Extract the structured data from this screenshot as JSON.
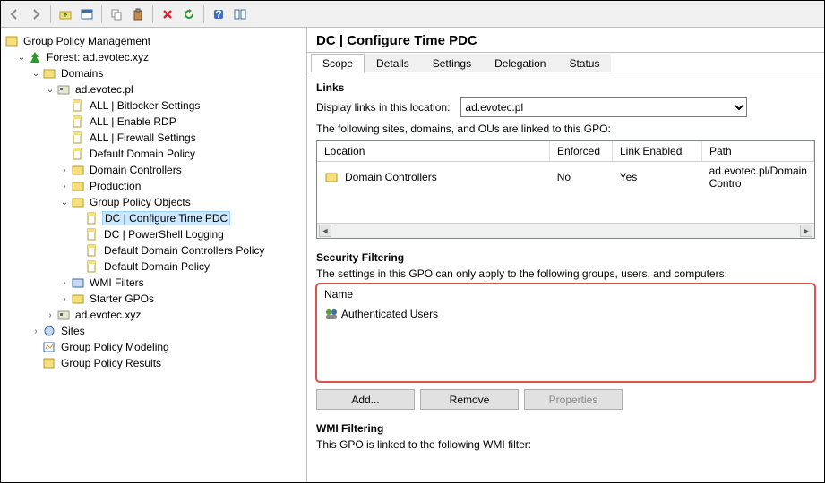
{
  "toolbar_icons": [
    "arrow-left-icon",
    "arrow-right-icon",
    "folder-up-icon",
    "window-icon",
    "copy-icon",
    "paste-icon",
    "delete-icon",
    "refresh-icon",
    "help-icon",
    "tile-icon"
  ],
  "tree": {
    "root": "Group Policy Management",
    "forest": "Forest: ad.evotec.xyz",
    "domains": "Domains",
    "domain": "ad.evotec.pl",
    "items": [
      "ALL | Bitlocker Settings",
      "ALL | Enable RDP",
      "ALL | Firewall Settings",
      "Default Domain Policy",
      "Domain Controllers",
      "Production",
      "Group Policy Objects"
    ],
    "gpo_children": [
      "DC | Configure Time PDC",
      "DC | PowerShell Logging",
      "Default Domain Controllers Policy",
      "Default Domain Policy"
    ],
    "after": [
      "WMI Filters",
      "Starter GPOs"
    ],
    "domain2": "ad.evotec.xyz",
    "sites": "Sites",
    "modeling": "Group Policy Modeling",
    "results": "Group Policy Results"
  },
  "header": "DC | Configure Time PDC",
  "tabs": [
    "Scope",
    "Details",
    "Settings",
    "Delegation",
    "Status"
  ],
  "links": {
    "title": "Links",
    "display": "Display links in this location:",
    "combo": "ad.evotec.pl",
    "caption": "The following sites, domains, and OUs are linked to this GPO:",
    "cols": [
      "Location",
      "Enforced",
      "Link Enabled",
      "Path"
    ],
    "row": {
      "loc": "Domain Controllers",
      "enf": "No",
      "le": "Yes",
      "path": "ad.evotec.pl/Domain Contro"
    }
  },
  "sec": {
    "title": "Security Filtering",
    "caption": "The settings in this GPO can only apply to the following groups, users, and computers:",
    "col": "Name",
    "row": "Authenticated Users",
    "buttons": [
      "Add...",
      "Remove",
      "Properties"
    ]
  },
  "wmi": {
    "title": "WMI Filtering",
    "caption": "This GPO is linked to the following WMI filter:"
  }
}
